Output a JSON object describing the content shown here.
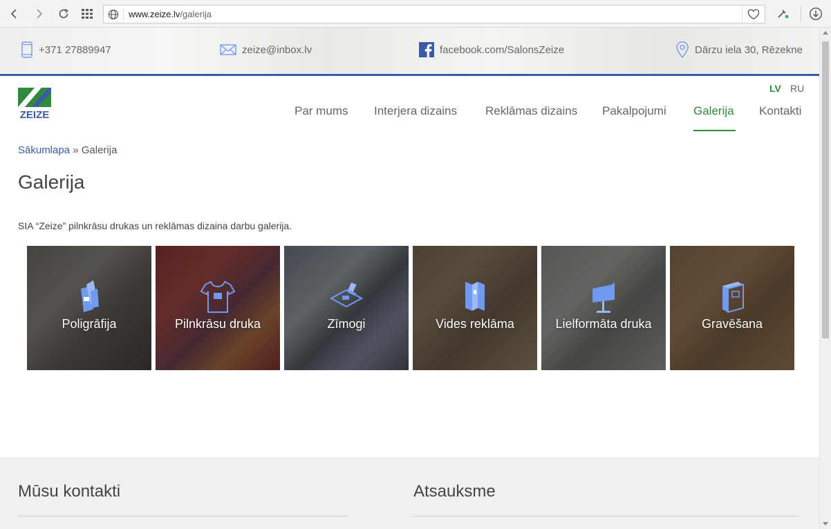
{
  "browser": {
    "url_domain": "www.zeize.lv",
    "url_path": "/galerija"
  },
  "topbar": {
    "phone": "+371 27889947",
    "email": "zeize@inbox.lv",
    "facebook": "facebook.com/SalonsZeize",
    "address": "Dārzu iela 30, Rēzekne"
  },
  "header": {
    "logo_text": "ZEIZE",
    "lang_active": "LV",
    "lang_other": "RU",
    "menu": [
      {
        "label": "Par mums"
      },
      {
        "label": "Interjera dizains"
      },
      {
        "label": "Reklāmas dizains"
      },
      {
        "label": "Pakalpojumi"
      },
      {
        "label": "Galerija"
      },
      {
        "label": "Kontakti"
      }
    ]
  },
  "breadcrumb": {
    "home": "Sākumlapa",
    "separator": "»",
    "current": "Galerija"
  },
  "page": {
    "title": "Galerija",
    "intro": "SIA “Zeize” pilnkrāsu drukas un reklāmas dizaina darbu galerija."
  },
  "gallery": [
    {
      "label": "Poligrāfija",
      "icon": "paper-icon"
    },
    {
      "label": "Pilnkrāsu druka",
      "icon": "tshirt-icon"
    },
    {
      "label": "Zīmogi",
      "icon": "stamp-icon"
    },
    {
      "label": "Vides reklāma",
      "icon": "banner-icon"
    },
    {
      "label": "Lielformāta druka",
      "icon": "billboard-icon"
    },
    {
      "label": "Gravēšana",
      "icon": "box-icon"
    }
  ],
  "footer": {
    "contacts_title": "Mūsu kontakti",
    "feedback_title": "Atsauksme"
  },
  "colors": {
    "brand_blue": "#3a5ba8",
    "brand_green": "#2e8b3d",
    "icon_blue": "#6f9af0"
  }
}
